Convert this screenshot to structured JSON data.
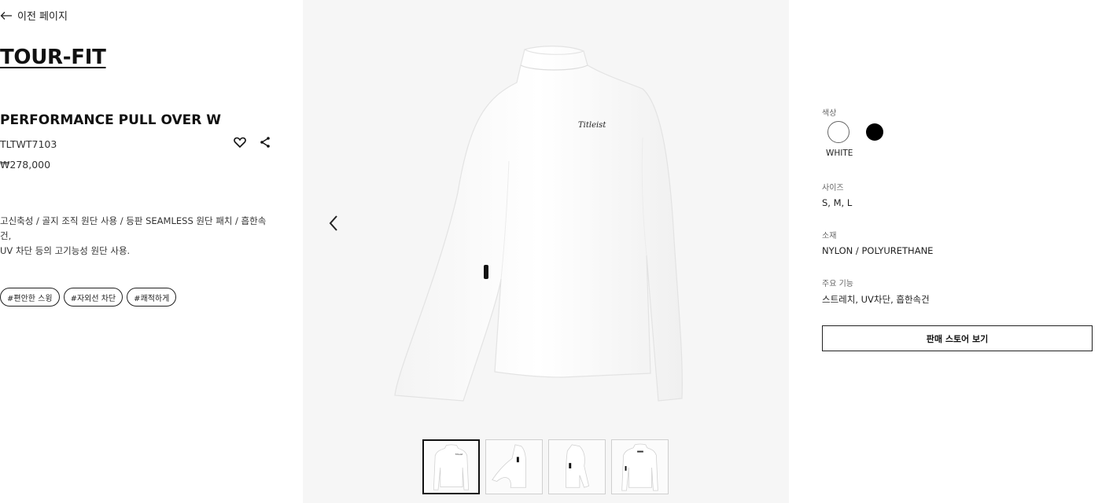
{
  "nav": {
    "back_label": "이전 페이지"
  },
  "product": {
    "collection": "TOUR-FIT",
    "name": "PERFORMANCE PULL OVER W",
    "sku": "TLTWT7103",
    "price": "₩278,000",
    "description_line1": "고신축성 / 골지 조직 원단 사용 / 등판 SEAMLESS 원단 패치 / 흡한속건,",
    "description_line2": "UV 차단 등의 고기능성 원단 사용.",
    "brand_mark": "Titleist"
  },
  "tags": [
    "#편안한 스윙",
    "#자외선 차단",
    "#쾌적하게"
  ],
  "gallery": {
    "active_index": 0,
    "thumb_count": 4
  },
  "options": {
    "color_label": "색상",
    "colors": [
      {
        "name": "WHITE",
        "hex": "#ffffff"
      },
      {
        "name": "BLACK",
        "hex": "#000000"
      }
    ],
    "selected_color": "WHITE",
    "size_label": "사이즈",
    "sizes": "S, M, L",
    "material_label": "소재",
    "material": "NYLON / POLYURETHANE",
    "features_label": "주요 기능",
    "features": "스트레치, UV차단, 흡한속건"
  },
  "store_button": "판매 스토어 보기",
  "icons": {
    "back": "arrow-left-icon",
    "wishlist": "heart-icon",
    "share": "share-icon",
    "prev": "chevron-left-icon",
    "next": "chevron-right-icon"
  }
}
